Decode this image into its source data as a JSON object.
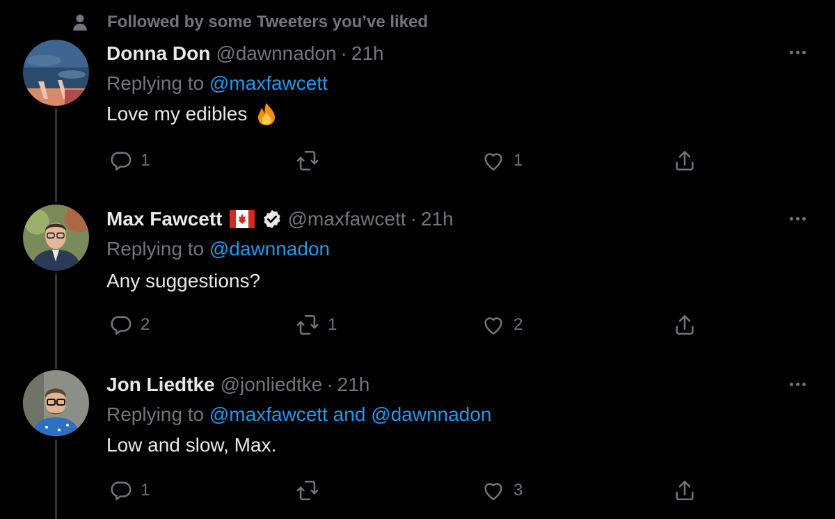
{
  "social_context": {
    "text": "Followed by some Tweeters you’ve liked",
    "icon": "person-icon"
  },
  "colors": {
    "background": "#000000",
    "text": "#e7e9ea",
    "muted": "#71767b",
    "link": "#1d9bf0",
    "thread": "#333639"
  },
  "tweets": [
    {
      "name": "Donna Don",
      "handle": "@dawnnadon",
      "dot": "·",
      "time": "21h",
      "reply_prefix": "Replying to ",
      "reply_mentions": "@maxfawcett",
      "text": "Love my edibles",
      "emoji": "fire",
      "verified": false,
      "flag": "",
      "actions": {
        "reply": "1",
        "retweet": "",
        "like": "1"
      }
    },
    {
      "name": "Max Fawcett",
      "handle": "@maxfawcett",
      "dot": "·",
      "time": "21h",
      "reply_prefix": "Replying to ",
      "reply_mentions": "@dawnnadon",
      "text": "Any suggestions?",
      "emoji": "",
      "verified": true,
      "flag": "canada-flag",
      "actions": {
        "reply": "2",
        "retweet": "1",
        "like": "2"
      }
    },
    {
      "name": "Jon Liedtke",
      "handle": "@jonliedtke",
      "dot": "·",
      "time": "21h",
      "reply_prefix": "Replying to ",
      "reply_mentions": "@maxfawcett and @dawnnadon",
      "text": "Low and slow, Max.",
      "emoji": "",
      "verified": false,
      "flag": "",
      "actions": {
        "reply": "1",
        "retweet": "",
        "like": "3"
      }
    }
  ]
}
